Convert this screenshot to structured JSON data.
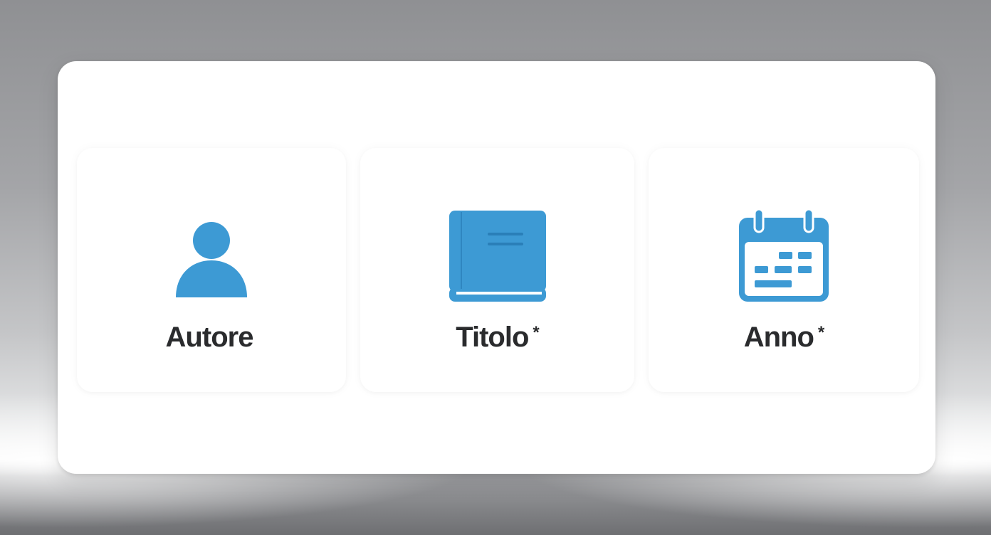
{
  "fields": [
    {
      "key": "autore",
      "label": "Autore",
      "icon": "person-icon",
      "required_mark": ""
    },
    {
      "key": "titolo",
      "label": "Titolo",
      "icon": "book-icon",
      "required_mark": "*"
    },
    {
      "key": "anno",
      "label": "Anno",
      "icon": "calendar-icon",
      "required_mark": "*"
    }
  ],
  "colors": {
    "accent": "#3d9ad4",
    "text": "#2a2b2d",
    "panel": "#ffffff"
  }
}
